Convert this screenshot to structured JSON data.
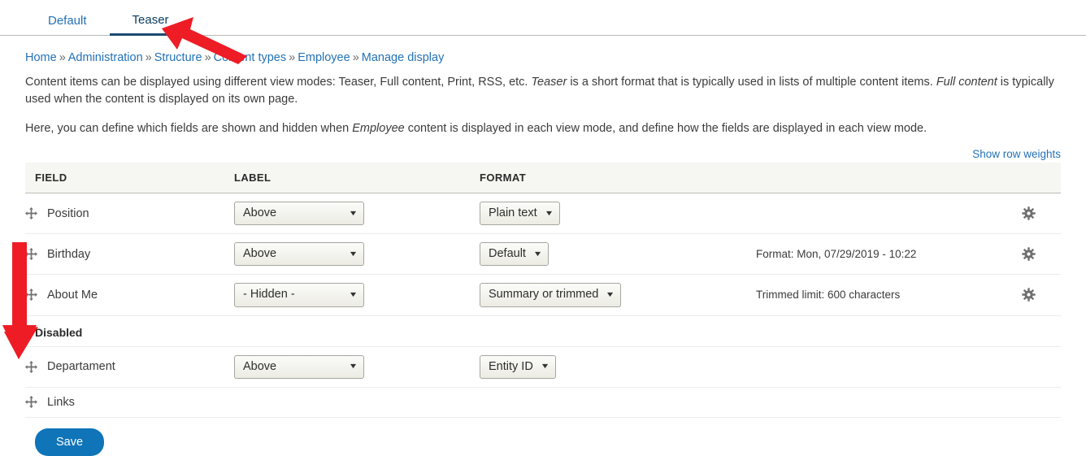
{
  "tabs": [
    {
      "label": "Default",
      "active": false
    },
    {
      "label": "Teaser",
      "active": true
    }
  ],
  "breadcrumb": {
    "items": [
      "Home",
      "Administration",
      "Structure",
      "Content types",
      "Employee",
      "Manage display"
    ],
    "separator": "»"
  },
  "description": {
    "p1_a": "Content items can be displayed using different view modes: Teaser, Full content, Print, RSS, etc. ",
    "p1_em1": "Teaser",
    "p1_b": " is a short format that is typically used in lists of multiple content items. ",
    "p1_em2": "Full content",
    "p1_c": " is typically used when the content is displayed on its own page.",
    "p2_a": "Here, you can define which fields are shown and hidden when ",
    "p2_em1": "Employee",
    "p2_b": " content is displayed in each view mode, and define how the fields are displayed in each view mode."
  },
  "show_row_weights": "Show row weights",
  "table": {
    "headers": {
      "field": "FIELD",
      "label": "LABEL",
      "format": "FORMAT",
      "settings": "",
      "gear": ""
    },
    "rows": [
      {
        "kind": "field",
        "name": "Position",
        "label_value": "Above",
        "format_value": "Plain text",
        "settings_summary": "",
        "has_gear": true
      },
      {
        "kind": "field",
        "name": "Birthday",
        "label_value": "Above",
        "format_value": "Default",
        "settings_summary": "Format: Mon, 07/29/2019 - 10:22",
        "has_gear": true
      },
      {
        "kind": "field",
        "name": "About Me",
        "label_value": "- Hidden -",
        "format_value": "Summary or trimmed",
        "settings_summary": "Trimmed limit: 600 characters",
        "has_gear": true
      },
      {
        "kind": "region",
        "name": "Disabled"
      },
      {
        "kind": "field",
        "name": "Departament",
        "label_value": "Above",
        "format_value": "Entity ID",
        "settings_summary": "",
        "has_gear": false
      },
      {
        "kind": "field",
        "name": "Links",
        "label_value": "",
        "format_value": "",
        "settings_summary": "",
        "has_gear": false
      }
    ]
  },
  "save_button": "Save",
  "icons": {
    "drag": "drag-move-icon",
    "gear": "gear-icon",
    "caret": "▼"
  },
  "colors": {
    "link": "#2372b5",
    "active_tab_underline": "#1b4b72",
    "annotation": "#ee1c25",
    "primary_button": "#0f74b8",
    "table_header_bg": "#f6f6f2"
  },
  "annotations": [
    {
      "name": "arrow-pointing-to-teaser-tab",
      "direction": "up-left"
    },
    {
      "name": "arrow-pointing-down-left-column",
      "direction": "down"
    }
  ]
}
